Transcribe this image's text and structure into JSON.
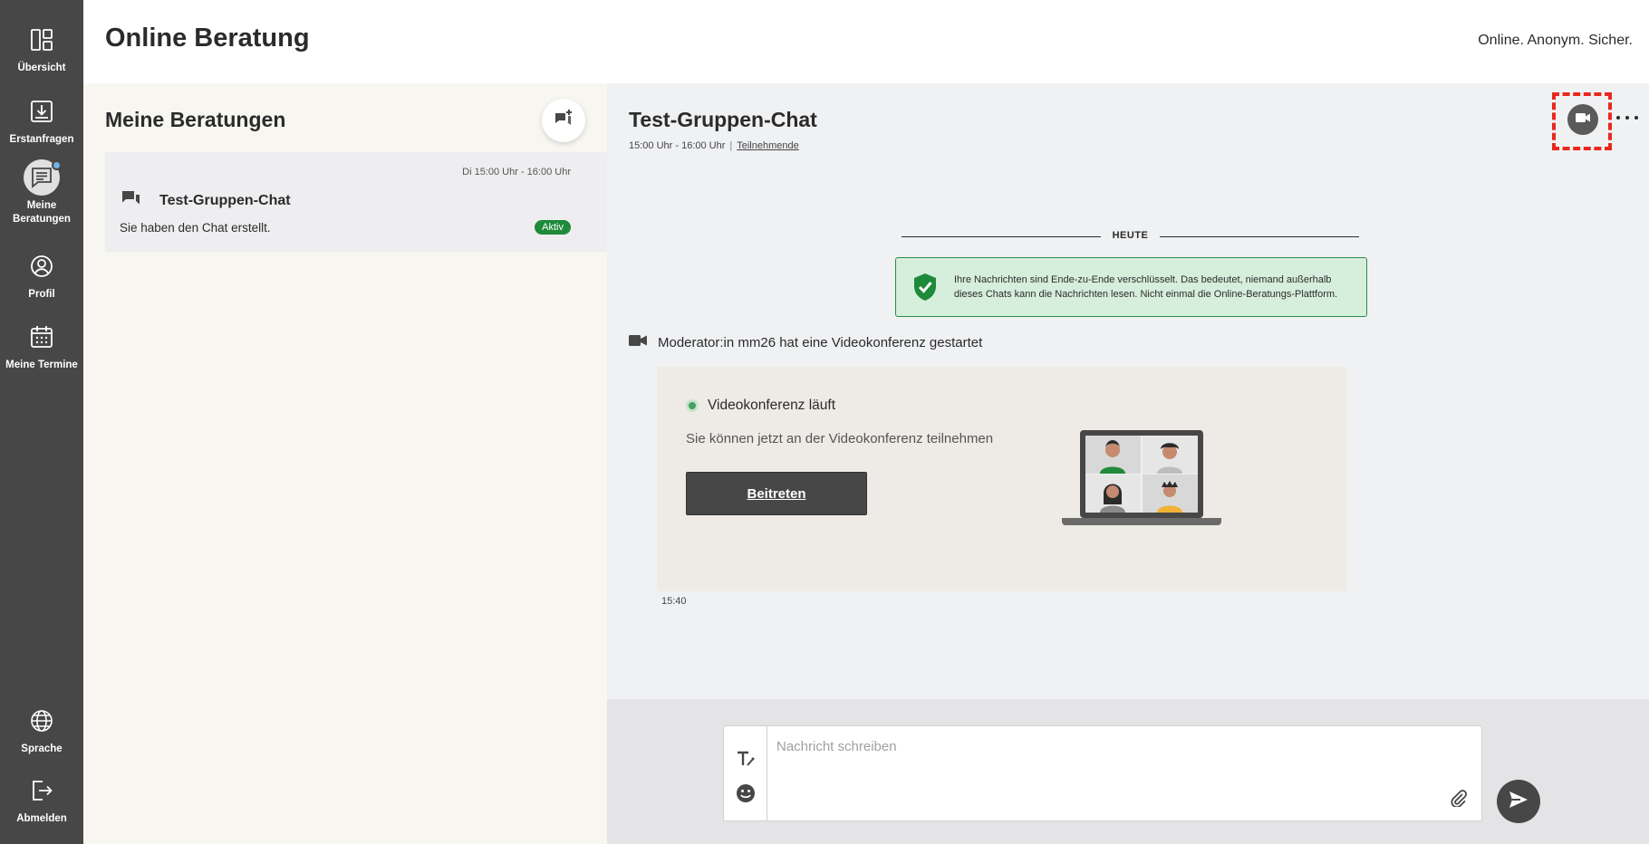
{
  "header": {
    "title": "Online Beratung",
    "claim": "Online. Anonym. Sicher."
  },
  "sidebar": {
    "items": [
      {
        "label": "Übersicht",
        "icon": "dashboard-icon"
      },
      {
        "label": "Erstanfragen",
        "icon": "inbox-download-icon"
      },
      {
        "label": "Meine Beratungen",
        "icon": "message-list-icon",
        "active": true
      },
      {
        "label": "Profil",
        "icon": "user-circle-icon"
      },
      {
        "label": "Meine Termine",
        "icon": "calendar-icon"
      }
    ],
    "bottom_items": [
      {
        "label": "Sprache",
        "icon": "globe-icon"
      },
      {
        "label": "Abmelden",
        "icon": "logout-icon"
      }
    ]
  },
  "list": {
    "title": "Meine Beratungen",
    "sessions": [
      {
        "date": "Di 15:00 Uhr - 16:00 Uhr",
        "name": "Test-Gruppen-Chat",
        "last_message": "Sie haben den Chat erstellt.",
        "status": "Aktiv"
      }
    ]
  },
  "chat": {
    "title": "Test-Gruppen-Chat",
    "time_range": "15:00 Uhr - 16:00 Uhr",
    "separator": "|",
    "participants_link": "Teilnehmende",
    "day_divider": "HEUTE",
    "e2e_notice": "Ihre Nachrichten sind Ende-zu-Ende verschlüsselt. Das bedeutet, niemand außerhalb dieses Chats kann die Nachrichten lesen. Nicht einmal die Online-Beratungs-Plattform.",
    "event_text": "Moderator:in mm26 hat eine Videokonferenz gestartet",
    "video_card": {
      "status": "Videokonferenz läuft",
      "description": "Sie können jetzt an der Videokonferenz teilnehmen",
      "join_label": "Beitreten"
    },
    "message_time": "15:40"
  },
  "composer": {
    "placeholder": "Nachricht schreiben"
  },
  "colors": {
    "sidebar_bg": "#474747",
    "accent_green": "#1e8a3a",
    "focus_red": "#e8281e",
    "list_bg": "#f8f6f1",
    "chat_bg": "#f0f1f3"
  }
}
